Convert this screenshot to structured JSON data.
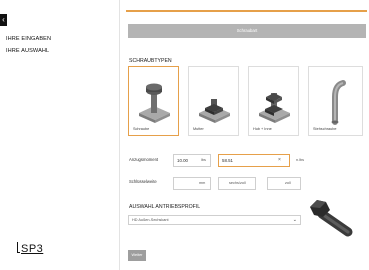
{
  "sidebar": {
    "back_glyph": "‹",
    "items": [
      {
        "label": "IHRE EINGABEN"
      },
      {
        "label": "IHRE AUSWAHL"
      }
    ],
    "logo_text": "SP3"
  },
  "header": {
    "bar_label": "Schraubart"
  },
  "accent_color": "#e6a04a",
  "schraubenart": {
    "title": "SCHRAUBTYPEN",
    "options": [
      {
        "label": "Schraube",
        "icon": "bolt-icon",
        "selected": true
      },
      {
        "label": "Mutter",
        "icon": "nut-icon",
        "selected": false
      },
      {
        "label": "Hub + Inne",
        "icon": "bolt-nut-icon",
        "selected": false
      },
      {
        "label": "Stehschraube",
        "icon": "stud-icon",
        "selected": false
      }
    ]
  },
  "form": {
    "anzugsmoment": {
      "label": "Anzugsmoment",
      "value1": "10.00",
      "unit1": "lbs",
      "value2": "58.51",
      "unit2": "n.lbs",
      "clear": "×"
    },
    "schluesselweite": {
      "label": "Schlüsselweite",
      "unit1": "mm",
      "unit2": "sechs/zoll",
      "unit3": "zoll"
    }
  },
  "antrieb": {
    "title": "AUSWAHL ANTRIEBSPROFIL",
    "selected": "HD Außen-Sechskant",
    "chevron": "⌄"
  },
  "footer": {
    "next_label": "Weiter"
  }
}
